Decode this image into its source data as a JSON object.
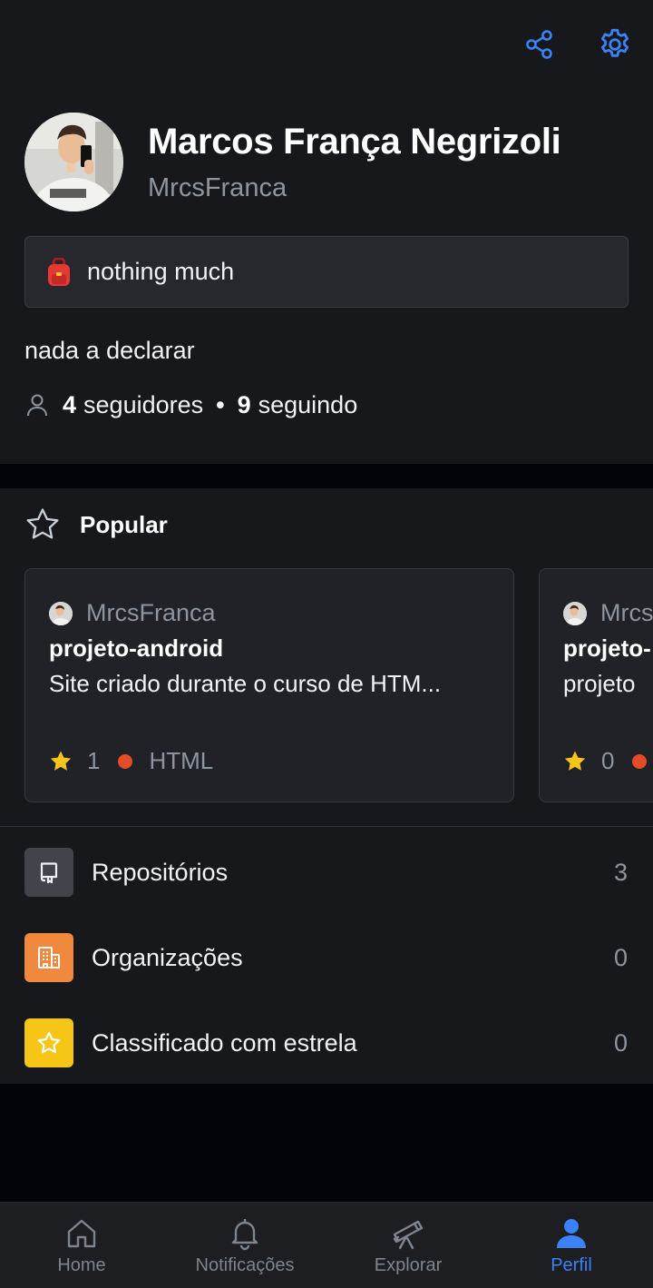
{
  "profile": {
    "name": "Marcos França Negrizoli",
    "username": "MrcsFranca",
    "status_emoji": "school-bag",
    "status": "nothing much",
    "bio": "nada a declarar",
    "followers_count": "4",
    "followers_label": "seguidores",
    "separator": "•",
    "following_count": "9",
    "following_label": "seguindo"
  },
  "popular": {
    "title": "Popular",
    "cards": [
      {
        "owner": "MrcsFranca",
        "name": "projeto-android",
        "description": "Site criado durante o curso de HTM...",
        "stars": "1",
        "language": "HTML",
        "language_color": "#e34c26"
      },
      {
        "owner": "MrcsFranca",
        "name": "projeto-",
        "description": "projeto",
        "stars": "0",
        "language": "",
        "language_color": "#e34c26"
      }
    ]
  },
  "menu": [
    {
      "label": "Repositórios",
      "count": "3",
      "icon": "repo-icon",
      "color": "#41444b"
    },
    {
      "label": "Organizações",
      "count": "0",
      "icon": "organization-icon",
      "color": "#f0883e"
    },
    {
      "label": "Classificado com estrela",
      "count": "0",
      "icon": "star-icon",
      "color": "#f5c518"
    }
  ],
  "nav": [
    {
      "label": "Home",
      "icon": "home-icon",
      "active": false
    },
    {
      "label": "Notificações",
      "icon": "bell-icon",
      "active": false
    },
    {
      "label": "Explorar",
      "icon": "telescope-icon",
      "active": false
    },
    {
      "label": "Perfil",
      "icon": "person-icon",
      "active": true
    }
  ],
  "colors": {
    "accent": "#3b82f6",
    "background": "#17181c",
    "star": "#f5c518",
    "html_language": "#e34c26"
  }
}
